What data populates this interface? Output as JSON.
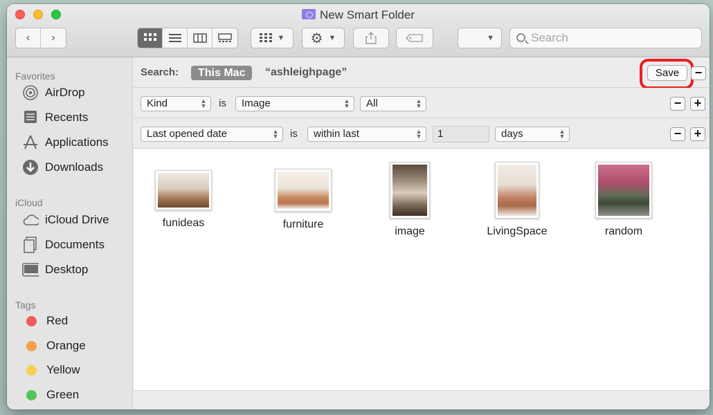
{
  "window": {
    "title": "New Smart Folder"
  },
  "toolbar": {
    "search_placeholder": "Search",
    "view_icons": [
      "icon-view-icon",
      "list-view-icon",
      "column-view-icon",
      "gallery-view-icon"
    ]
  },
  "sidebar": {
    "favorites_header": "Favorites",
    "favorites": [
      {
        "label": "AirDrop",
        "icon": "airdrop-icon"
      },
      {
        "label": "Recents",
        "icon": "recents-icon"
      },
      {
        "label": "Applications",
        "icon": "applications-icon"
      },
      {
        "label": "Downloads",
        "icon": "downloads-icon"
      }
    ],
    "icloud_header": "iCloud",
    "icloud": [
      {
        "label": "iCloud Drive",
        "icon": "cloud-icon"
      },
      {
        "label": "Documents",
        "icon": "documents-icon"
      },
      {
        "label": "Desktop",
        "icon": "desktop-icon"
      }
    ],
    "tags_header": "Tags",
    "tags": [
      {
        "label": "Red",
        "color": "#f35b55"
      },
      {
        "label": "Orange",
        "color": "#f5a04a"
      },
      {
        "label": "Yellow",
        "color": "#f7cf4b"
      },
      {
        "label": "Green",
        "color": "#52c559"
      }
    ]
  },
  "search_bar": {
    "label": "Search:",
    "scope_selected": "This Mac",
    "scope_other": "“ashleighpage”",
    "save_label": "Save"
  },
  "rules": [
    {
      "attribute": "Kind",
      "operator": "is",
      "value": "Image",
      "extra": "All"
    },
    {
      "attribute": "Last opened date",
      "operator": "is",
      "value": "within last",
      "number": "1",
      "unit": "days"
    }
  ],
  "files": [
    {
      "name": "funideas"
    },
    {
      "name": "furniture"
    },
    {
      "name": "image"
    },
    {
      "name": "LivingSpace"
    },
    {
      "name": "random"
    }
  ]
}
